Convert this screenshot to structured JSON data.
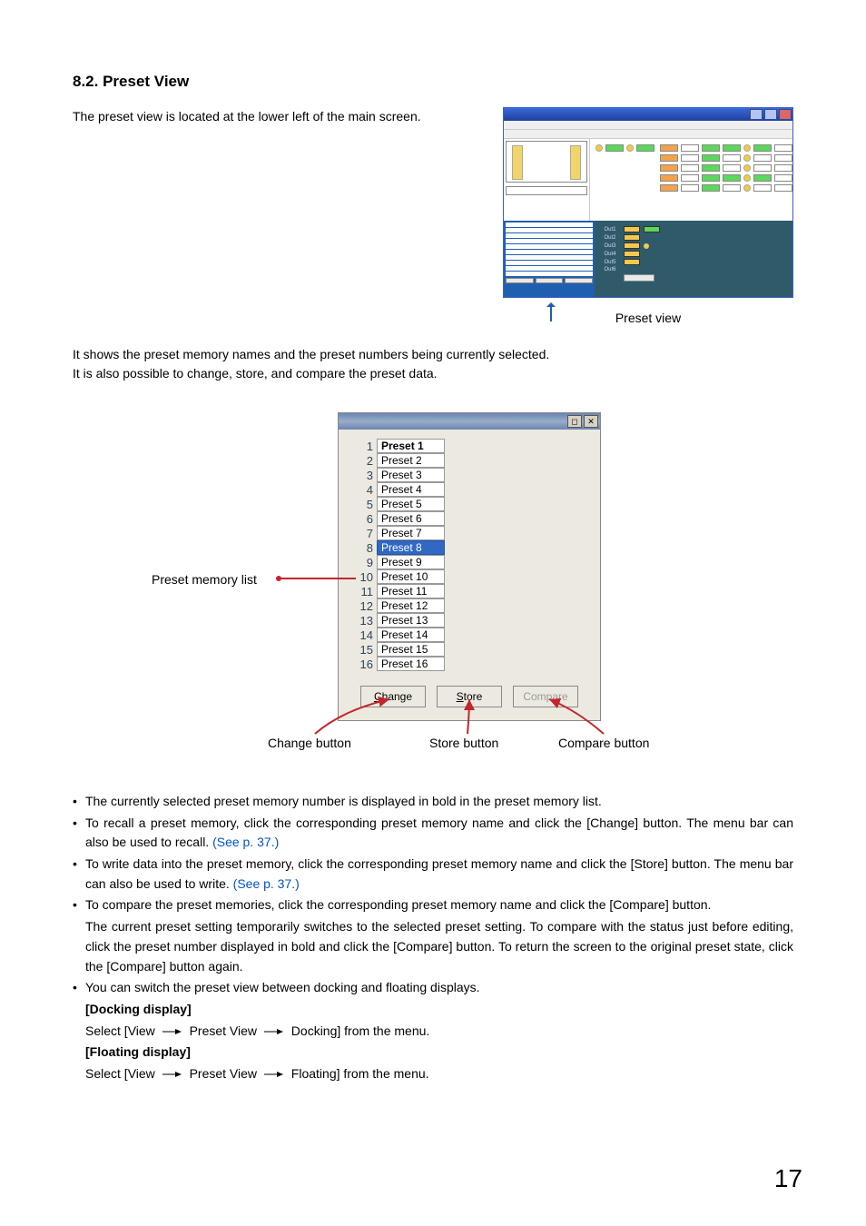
{
  "heading": "8.2. Preset View",
  "intro": "The preset view is located at the lower left of the main screen.",
  "screenshot_caption": "Preset view",
  "desc1": "It shows the preset memory names and the preset numbers being currently selected.",
  "desc2": "It is also possible to change, store, and compare the preset data.",
  "fig2": {
    "label_list": "Preset memory list",
    "btn_change_ul": "C",
    "btn_change_rest": "hange",
    "btn_store_ul": "S",
    "btn_store_rest": "tore",
    "btn_compare": "Compare",
    "label_change": "Change button",
    "label_store": "Store button",
    "label_compare": "Compare button",
    "presets": [
      {
        "num": 1,
        "name": "Preset 1",
        "bold": true,
        "sel": false
      },
      {
        "num": 2,
        "name": "Preset 2",
        "bold": false,
        "sel": false
      },
      {
        "num": 3,
        "name": "Preset 3",
        "bold": false,
        "sel": false
      },
      {
        "num": 4,
        "name": "Preset 4",
        "bold": false,
        "sel": false
      },
      {
        "num": 5,
        "name": "Preset 5",
        "bold": false,
        "sel": false
      },
      {
        "num": 6,
        "name": "Preset 6",
        "bold": false,
        "sel": false
      },
      {
        "num": 7,
        "name": "Preset 7",
        "bold": false,
        "sel": false
      },
      {
        "num": 8,
        "name": "Preset 8",
        "bold": false,
        "sel": true
      },
      {
        "num": 9,
        "name": "Preset 9",
        "bold": false,
        "sel": false
      },
      {
        "num": 10,
        "name": "Preset 10",
        "bold": false,
        "sel": false
      },
      {
        "num": 11,
        "name": "Preset 11",
        "bold": false,
        "sel": false
      },
      {
        "num": 12,
        "name": "Preset 12",
        "bold": false,
        "sel": false
      },
      {
        "num": 13,
        "name": "Preset 13",
        "bold": false,
        "sel": false
      },
      {
        "num": 14,
        "name": "Preset 14",
        "bold": false,
        "sel": false
      },
      {
        "num": 15,
        "name": "Preset 15",
        "bold": false,
        "sel": false
      },
      {
        "num": 16,
        "name": "Preset 16",
        "bold": false,
        "sel": false
      }
    ]
  },
  "bullets": {
    "b1": "The currently selected preset memory number is displayed in bold in the preset memory list.",
    "b2a": "To recall a preset memory, click the corresponding preset memory name and click the [Change] button. The menu bar can also be used to recall.",
    "b3a": "To write data into the preset memory, click the corresponding preset memory name and click the [Store] button. The menu bar can also be used to write.",
    "see37": "(See p. 37.)",
    "b4": "To compare the preset memories, click the corresponding preset memory name and click the [Compare] button.",
    "b4cont": "The current preset setting temporarily switches to the selected preset setting. To compare with the status just before editing, click the preset number displayed in bold and click the [Compare] button. To return the screen to the original preset state, click the [Compare] button again.",
    "b5": "You can switch the preset view between docking and floating displays.",
    "dock_hdr": "[Docking display]",
    "float_hdr": "[Floating display]",
    "select_prefix": "Select [View",
    "preset_view": "Preset View",
    "docking_suffix": "Docking] from the menu.",
    "floating_suffix": "Floating] from the menu."
  },
  "page_number": "17"
}
